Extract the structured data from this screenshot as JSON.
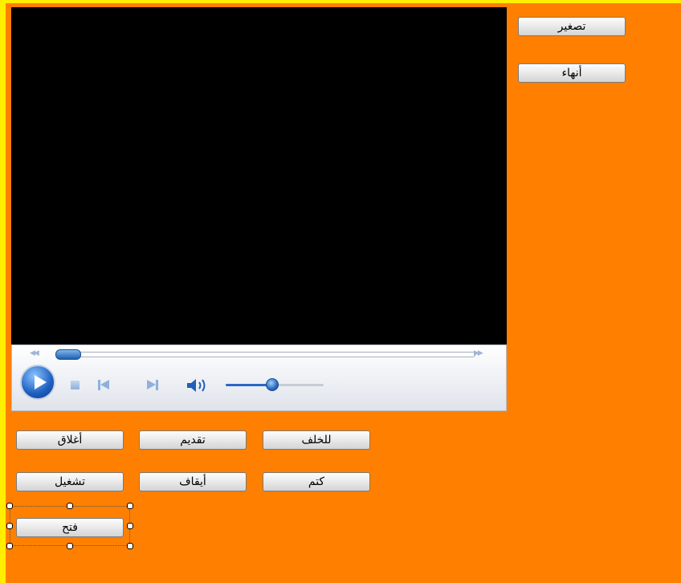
{
  "form": {
    "background": "#ff8000",
    "edge_color": "#ffee00"
  },
  "side_buttons": {
    "minimize_label": "تصغير",
    "end_label": "أنهاء"
  },
  "player": {
    "seek_position": 0.03,
    "volume_level": 0.5
  },
  "buttons": {
    "close_label": "أغلاق",
    "forward_label": "تقديم",
    "back_label": "للخلف",
    "play_label": "تشغيل",
    "stop_label": "أيقاف",
    "mute_label": "كتم",
    "open_label": "فتح"
  },
  "icons": {
    "rewind": "rewind-icon",
    "fast_forward": "fast-forward-icon",
    "play": "play-icon",
    "stop": "stop-icon",
    "previous": "previous-icon",
    "next": "next-icon",
    "volume": "volume-icon"
  },
  "designer_selection": {
    "selected_control": "open-button"
  }
}
